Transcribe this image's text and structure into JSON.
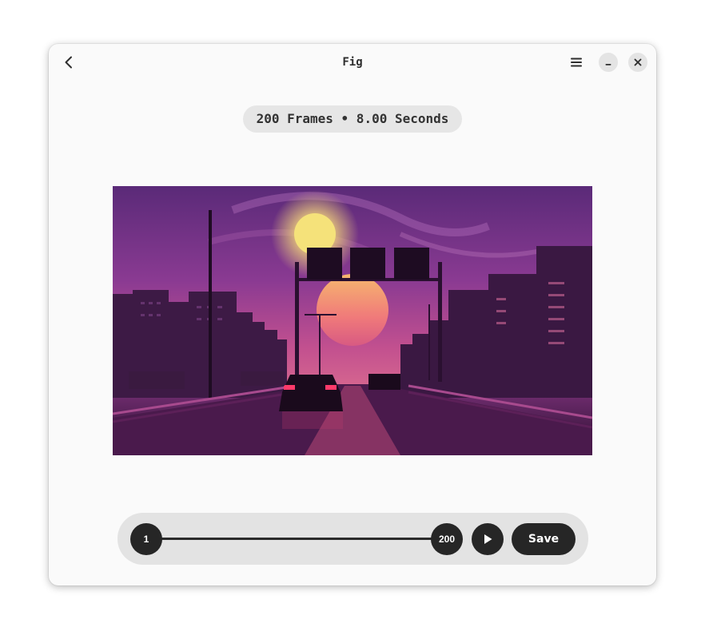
{
  "window": {
    "title": "Fig"
  },
  "info": {
    "text": "200 Frames • 8.00 Seconds"
  },
  "icons": {
    "back": "back-arrow-icon",
    "menu": "hamburger-menu-icon",
    "minimize": "minimize-icon",
    "close": "close-icon",
    "play": "play-icon"
  },
  "trim": {
    "start_frame": "1",
    "end_frame": "200"
  },
  "actions": {
    "save_label": "Save"
  },
  "colors": {
    "window_bg": "#fafafa",
    "pill_bg": "#e6e6e6",
    "control_bar_bg": "#e3e3e3",
    "button_dark": "#262626"
  }
}
